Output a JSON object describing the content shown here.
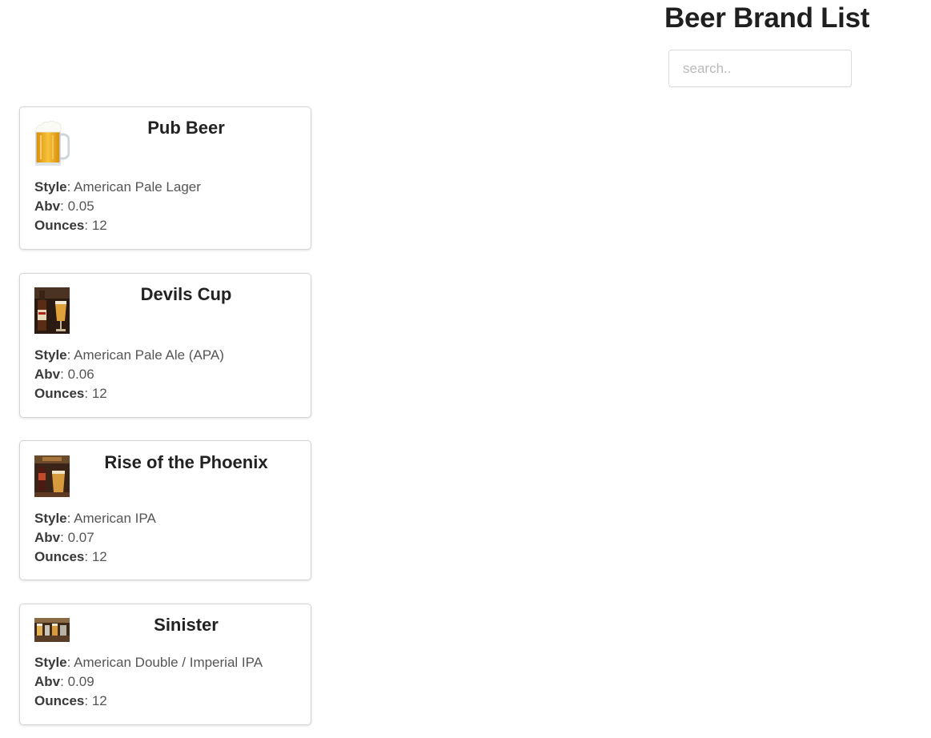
{
  "header": {
    "title": "Beer Brand List"
  },
  "search": {
    "placeholder": "search..",
    "value": ""
  },
  "labels": {
    "style": "Style",
    "abv": "Abv",
    "ounces": "Ounces",
    "separator": ": "
  },
  "beers": [
    {
      "name": "Pub Beer",
      "style": "American Pale Lager",
      "abv": "0.05",
      "ounces": "12",
      "image": "beer-mug-icon"
    },
    {
      "name": "Devils Cup",
      "style": "American Pale Ale (APA)",
      "abv": "0.06",
      "ounces": "12",
      "image": "beer-bottle-photo"
    },
    {
      "name": "Rise of the Phoenix",
      "style": "American IPA",
      "abv": "0.07",
      "ounces": "12",
      "image": "beer-glass-photo"
    },
    {
      "name": "Sinister",
      "style": "American Double / Imperial IPA",
      "abv": "0.09",
      "ounces": "12",
      "image": "beer-bar-photo"
    }
  ]
}
